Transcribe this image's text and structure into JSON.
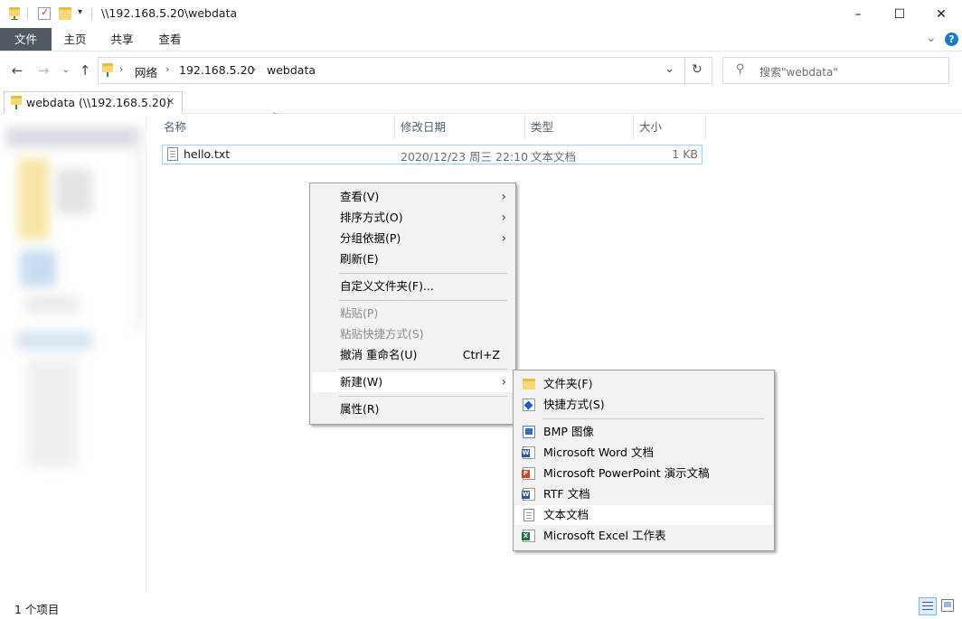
{
  "window": {
    "title": "\\\\192.168.5.20\\webdata",
    "minimize": "–",
    "maximize": "☐",
    "close": "✕"
  },
  "ribbon": {
    "tabs": [
      "文件",
      "主页",
      "共享",
      "查看"
    ],
    "help": "?",
    "expand": "⌄"
  },
  "address": {
    "crumbs": [
      "网络",
      "192.168.5.20",
      "webdata"
    ],
    "search_placeholder": "搜索\"webdata\""
  },
  "tab": {
    "label": "webdata (\\\\192.168.5.20)",
    "close": "✕"
  },
  "columns": {
    "name": "名称",
    "date": "修改日期",
    "type": "类型",
    "size": "大小"
  },
  "files": [
    {
      "name": "hello.txt",
      "date": "2020/12/23 周三 22:10",
      "type": "文本文档",
      "size": "1 KB"
    }
  ],
  "context_menu": {
    "view": "查看(V)",
    "sort": "排序方式(O)",
    "group": "分组依据(P)",
    "refresh": "刷新(E)",
    "customize": "自定义文件夹(F)...",
    "paste": "粘贴(P)",
    "paste_shortcut": "粘贴快捷方式(S)",
    "undo": "撤消 重命名(U)",
    "undo_shortcut": "Ctrl+Z",
    "new": "新建(W)",
    "properties": "属性(R)"
  },
  "new_submenu": {
    "folder": "文件夹(F)",
    "shortcut": "快捷方式(S)",
    "bmp": "BMP 图像",
    "word": "Microsoft Word 文档",
    "powerpoint": "Microsoft PowerPoint 演示文稿",
    "rtf": "RTF 文档",
    "text": "文本文档",
    "excel": "Microsoft Excel 工作表"
  },
  "status": {
    "item_count": "1 个项目"
  },
  "colors": {
    "file_tab_bg": "#505a63",
    "selection_border": "#99d1ff",
    "folder_yellow": "#f7d774",
    "help_blue": "#1979ca"
  }
}
